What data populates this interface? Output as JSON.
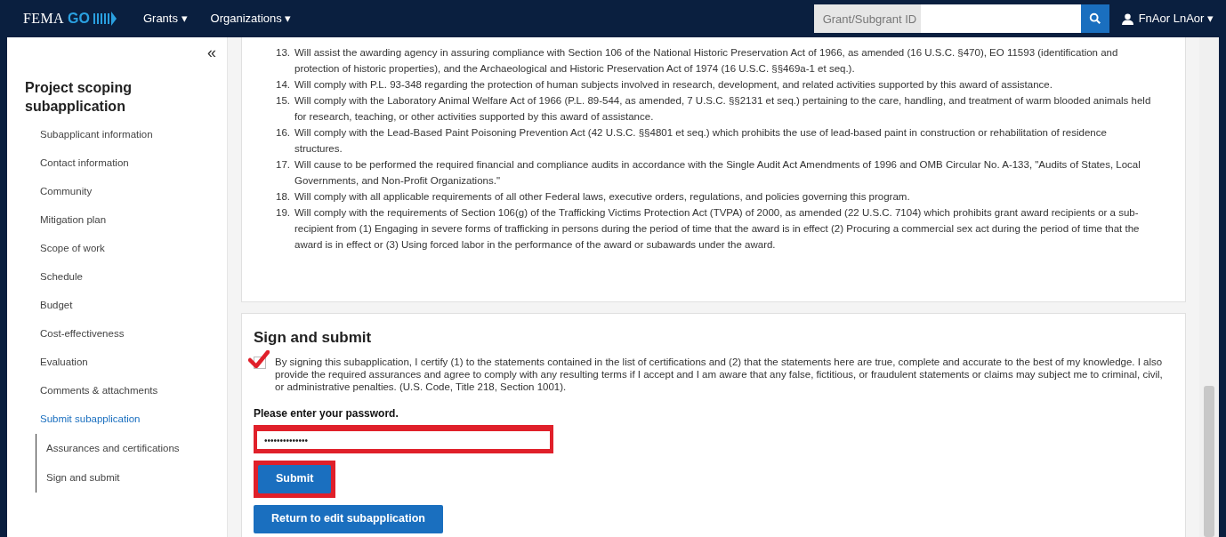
{
  "navbar": {
    "logo_text": "FEMA",
    "logo_accent": "GO",
    "menus": [
      {
        "label": "Grants",
        "caret": "▾"
      },
      {
        "label": "Organizations",
        "caret": "▾"
      }
    ],
    "search": {
      "placeholder": "Grant/Subgrant ID"
    },
    "user": {
      "name": "FnAor LnAor",
      "caret": "▾"
    }
  },
  "sidebar": {
    "collapse": "«",
    "title": "Project scoping subapplication",
    "items": [
      {
        "label": "Subapplicant information",
        "selected": false
      },
      {
        "label": "Contact information",
        "selected": false
      },
      {
        "label": "Community",
        "selected": false
      },
      {
        "label": "Mitigation plan",
        "selected": false
      },
      {
        "label": "Scope of work",
        "selected": false
      },
      {
        "label": "Schedule",
        "selected": false
      },
      {
        "label": "Budget",
        "selected": false
      },
      {
        "label": "Cost-effectiveness",
        "selected": false
      },
      {
        "label": "Evaluation",
        "selected": false
      },
      {
        "label": "Comments & attachments",
        "selected": false
      },
      {
        "label": "Submit subapplication",
        "selected": true,
        "children": [
          {
            "label": "Assurances and certifications",
            "selected": false
          },
          {
            "label": "Sign and submit",
            "selected": false
          }
        ]
      }
    ]
  },
  "assurances": [
    {
      "number": "13.",
      "text": "Will assist the awarding agency in assuring compliance with Section 106 of the National Historic Preservation Act of 1966, as amended (16 U.S.C. §470), EO 11593 (identification and protection of historic properties), and the Archaeological and Historic Preservation Act of 1974 (16 U.S.C. §§469a-1 et seq.)."
    },
    {
      "number": "14.",
      "text": "Will comply with P.L. 93-348 regarding the protection of human subjects involved in research, development, and related activities supported by this award of assistance."
    },
    {
      "number": "15.",
      "text": "Will comply with the Laboratory Animal Welfare Act of 1966 (P.L. 89-544, as amended, 7 U.S.C. §§2131 et seq.) pertaining to the care, handling, and treatment of warm blooded animals held for research, teaching, or other activities supported by this award of assistance."
    },
    {
      "number": "16.",
      "text": "Will comply with the Lead-Based Paint Poisoning Prevention Act (42 U.S.C. §§4801 et seq.) which prohibits the use of lead-based paint in construction or rehabilitation of residence structures."
    },
    {
      "number": "17.",
      "text": "Will cause to be performed the required financial and compliance audits in accordance with the Single Audit Act Amendments of 1996 and OMB Circular No. A-133, \"Audits of States, Local Governments, and Non-Profit Organizations.\""
    },
    {
      "number": "18.",
      "text": "Will comply with all applicable requirements of all other Federal laws, executive orders, regulations, and policies governing this program."
    },
    {
      "number": "19.",
      "text": "Will comply with the requirements of Section 106(g) of the Trafficking Victims Protection Act (TVPA) of 2000, as amended (22 U.S.C. 7104) which prohibits grant award recipients or a sub-recipient from (1) Engaging in severe forms of trafficking in persons during the period of time that the award is in effect (2) Procuring a commercial sex act during the period of time that the award is in effect or (3) Using forced labor in the performance of the award or subawards under the award."
    }
  ],
  "sign": {
    "title": "Sign and submit",
    "certify": {
      "checked": true,
      "text": "By signing this subapplication, I certify (1) to the statements contained in the list of certifications and (2) that the statements here are true, complete and accurate to the best of my knowledge. I also provide the required assurances and agree to comply with any resulting terms if I accept and I am aware that any false, fictitious, or fraudulent statements or claims may subject me to criminal, civil, or administrative penalties. (U.S. Code, Title 218, Section 1001)."
    },
    "password_label": "Please enter your password.",
    "password": {
      "value": "••••••••••••••",
      "highlighted": true
    },
    "buttons": [
      {
        "label": "Submit",
        "highlighted": true
      },
      {
        "label": "Return to edit subapplication",
        "highlighted": false
      }
    ]
  }
}
